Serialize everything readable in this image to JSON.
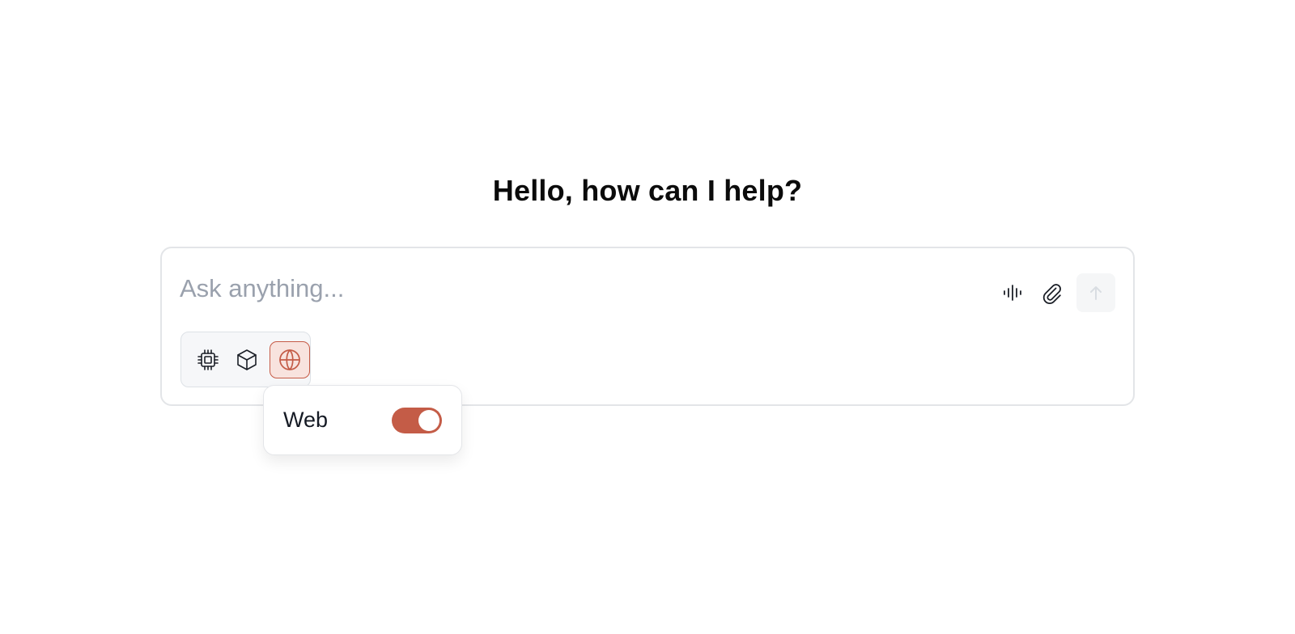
{
  "heading": "Hello, how can I help?",
  "composer": {
    "placeholder": "Ask anything...",
    "value": ""
  },
  "actions": {
    "voice_icon": "waveform-icon",
    "attach_icon": "paperclip-icon",
    "send_icon": "arrow-up-icon"
  },
  "modes": [
    {
      "icon": "cpu-chip-icon",
      "active": false
    },
    {
      "icon": "cube-icon",
      "active": false
    },
    {
      "icon": "globe-icon",
      "active": true
    }
  ],
  "web_popover": {
    "label": "Web",
    "enabled": true
  },
  "colors": {
    "accent": "#c45c47",
    "active_bg": "#f8e3de",
    "border": "#e3e5e8",
    "placeholder": "#9aa1ad"
  }
}
